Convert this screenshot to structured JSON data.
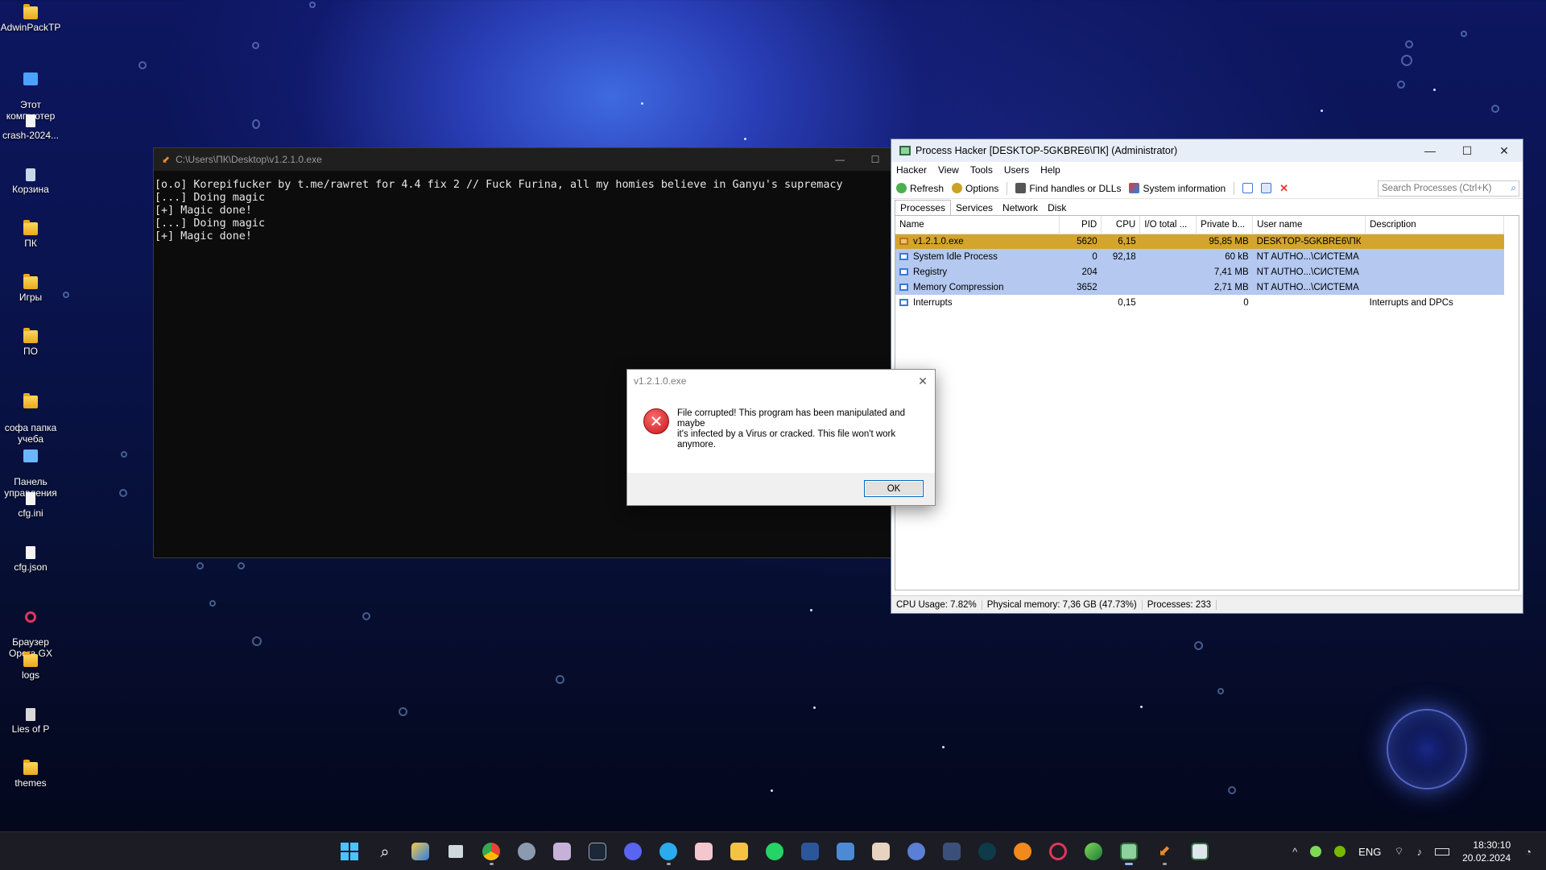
{
  "desktop": {
    "icons": [
      {
        "label": "AdwinPackTP",
        "kind": "folder"
      },
      {
        "label": "Этот\nкомпьютер",
        "kind": "pc"
      },
      {
        "label": "crash-2024...",
        "kind": "file"
      },
      {
        "label": "Корзина",
        "kind": "trash"
      },
      {
        "label": "ПК",
        "kind": "folder"
      },
      {
        "label": "Игры",
        "kind": "folder"
      },
      {
        "label": "ПО",
        "kind": "folder"
      },
      {
        "label": "софа папка\nучеба",
        "kind": "folder"
      },
      {
        "label": "Панель\nуправления",
        "kind": "panel"
      },
      {
        "label": "cfg.ini",
        "kind": "file"
      },
      {
        "label": "cfg.json",
        "kind": "file"
      },
      {
        "label": "Браузер\nOpera GX",
        "kind": "opera"
      },
      {
        "label": "logs",
        "kind": "folder"
      },
      {
        "label": "Lies of P",
        "kind": "game"
      },
      {
        "label": "themes",
        "kind": "folder"
      }
    ]
  },
  "console": {
    "title": "C:\\Users\\ПК\\Desktop\\v1.2.1.0.exe",
    "minimize": "—",
    "maximize": "☐",
    "lines": "[o.o] Korepifucker by t.me/rawret for 4.4 fix 2 // Fuck Furina, all my homies believe in Ganyu's supremacy\n[...] Doing magic\n[+] Magic done!\n[...] Doing magic\n[+] Magic done!"
  },
  "process_hacker": {
    "title": "Process Hacker [DESKTOP-5GKBRE6\\ПК] (Administrator)",
    "controls": {
      "minimize": "—",
      "maximize": "☐",
      "close": "✕"
    },
    "menu": [
      "Hacker",
      "View",
      "Tools",
      "Users",
      "Help"
    ],
    "toolbar": {
      "refresh": "Refresh",
      "options": "Options",
      "find_handles": "Find handles or DLLs",
      "system_info": "System information",
      "search_placeholder": "Search Processes (Ctrl+K)"
    },
    "tabs": [
      "Processes",
      "Services",
      "Network",
      "Disk"
    ],
    "columns": [
      "Name",
      "PID",
      "CPU",
      "I/O total ...",
      "Private b...",
      "User name",
      "Description"
    ],
    "rows": [
      {
        "name": "v1.2.1.0.exe",
        "pid": "5620",
        "cpu": "6,15",
        "io": "",
        "private": "95,85 MB",
        "user": "DESKTOP-5GKBRE6\\ПК",
        "desc": ""
      },
      {
        "name": "System Idle Process",
        "pid": "0",
        "cpu": "92,18",
        "io": "",
        "private": "60 kB",
        "user": "NT AUTHO...\\СИСТЕМА",
        "desc": ""
      },
      {
        "name": "Registry",
        "pid": "204",
        "cpu": "",
        "io": "",
        "private": "7,41 MB",
        "user": "NT AUTHO...\\СИСТЕМА",
        "desc": ""
      },
      {
        "name": "Memory Compression",
        "pid": "3652",
        "cpu": "",
        "io": "",
        "private": "2,71 MB",
        "user": "NT AUTHO...\\СИСТЕМА",
        "desc": ""
      },
      {
        "name": "Interrupts",
        "pid": "",
        "cpu": "0,15",
        "io": "",
        "private": "0",
        "user": "",
        "desc": "Interrupts and DPCs"
      }
    ],
    "status": {
      "cpu": "CPU Usage: 7.82%",
      "memory": "Physical memory: 7,36 GB (47.73%)",
      "processes": "Processes: 233"
    }
  },
  "dialog": {
    "title": "v1.2.1.0.exe",
    "close": "✕",
    "icon": "✕",
    "message": "File corrupted! This program has been manipulated and maybe\nit's infected by a Virus or cracked. This file won't work anymore.",
    "ok": "OK"
  },
  "taskbar": {
    "tray_chevron": "^",
    "language": "ENG",
    "time": "18:30:10",
    "date": "20.02.2024"
  }
}
